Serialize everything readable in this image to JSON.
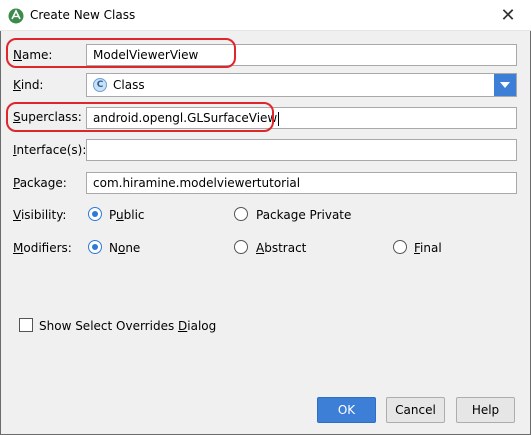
{
  "window": {
    "title": "Create New Class",
    "close_glyph": "✕"
  },
  "form": {
    "name_label_u": "N",
    "name_label_rest": "ame:",
    "name_value": "ModelViewerView",
    "kind_label_u": "K",
    "kind_label_rest": "ind:",
    "kind_icon_letter": "C",
    "kind_value": "Class",
    "superclass_label_u": "S",
    "superclass_label_rest": "uperclass:",
    "superclass_value": "android.opengl.GLSurfaceView",
    "interfaces_label_u": "I",
    "interfaces_label_rest": "nterface(s):",
    "interfaces_value": "",
    "package_label_u": "P",
    "package_label_rest": "ackage:",
    "package_value": "com.hiramine.modelviewertutorial",
    "visibility_label_u": "V",
    "visibility_label_rest": "isibility:",
    "visibility_options": [
      {
        "u": "u",
        "pre": "P",
        "post": "blic",
        "selected": true
      },
      {
        "u": "",
        "pre": "Package Private",
        "post": "",
        "selected": false
      }
    ],
    "modifiers_label_u": "M",
    "modifiers_label_rest": "odifiers:",
    "modifier_options": [
      {
        "pre": "N",
        "u": "o",
        "post": "ne",
        "selected": true
      },
      {
        "pre": "",
        "u": "A",
        "post": "bstract",
        "selected": false
      },
      {
        "pre": "",
        "u": "F",
        "post": "inal",
        "selected": false
      }
    ],
    "overrides_pre": "Show Select Overrides ",
    "overrides_u": "D",
    "overrides_post": "ialog",
    "overrides_checked": false
  },
  "buttons": {
    "ok": "OK",
    "cancel": "Cancel",
    "help": "Help"
  },
  "colors": {
    "accent": "#3d7ed6",
    "highlight": "#e0262a"
  },
  "icons": {
    "app": "android-studio-icon",
    "kind": "class-icon",
    "dropdown": "chevron-down-icon"
  }
}
